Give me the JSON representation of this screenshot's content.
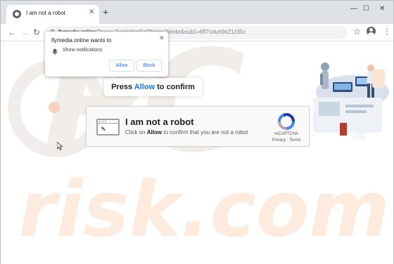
{
  "browser": {
    "tab_title": "I am not a robot",
    "new_tab_glyph": "+",
    "url_host": "flymedia.online",
    "url_rest": "/?p=mu2wcmdcgi5gi3bpgm3tenbr&sub1=6ff7cduh9e21z35c"
  },
  "notification": {
    "title": "flymedia.online wants to",
    "permission": "Show notifications",
    "allow_label": "Allow",
    "block_label": "Block"
  },
  "page": {
    "press_before": "Press",
    "press_accent": "Allow",
    "press_after": "to confirm",
    "captcha_title": "I am not a robot",
    "captcha_sub_before": "Click on",
    "captcha_sub_bold": "Allow",
    "captcha_sub_after": "to confirm that you are not a robot",
    "recaptcha_label": "reCAPTCHA",
    "recaptcha_links": "Privacy - Terms"
  },
  "watermark": {
    "top": "PC",
    "bottom": "risk.com"
  },
  "icons": {
    "tab_favicon": "globe-icon",
    "tab_close": "close-icon",
    "back": "arrow-left-icon",
    "forward": "arrow-right-icon",
    "reload": "reload-icon",
    "lock": "lock-icon",
    "bookmark": "star-icon",
    "account": "account-icon",
    "menu": "kebab-menu-icon",
    "bell": "bell-icon",
    "recaptcha": "recaptcha-logo-icon"
  },
  "colors": {
    "accent": "#1a73e8",
    "watermark_grey": "#f1ede9",
    "watermark_orange": "#fdebdd"
  }
}
